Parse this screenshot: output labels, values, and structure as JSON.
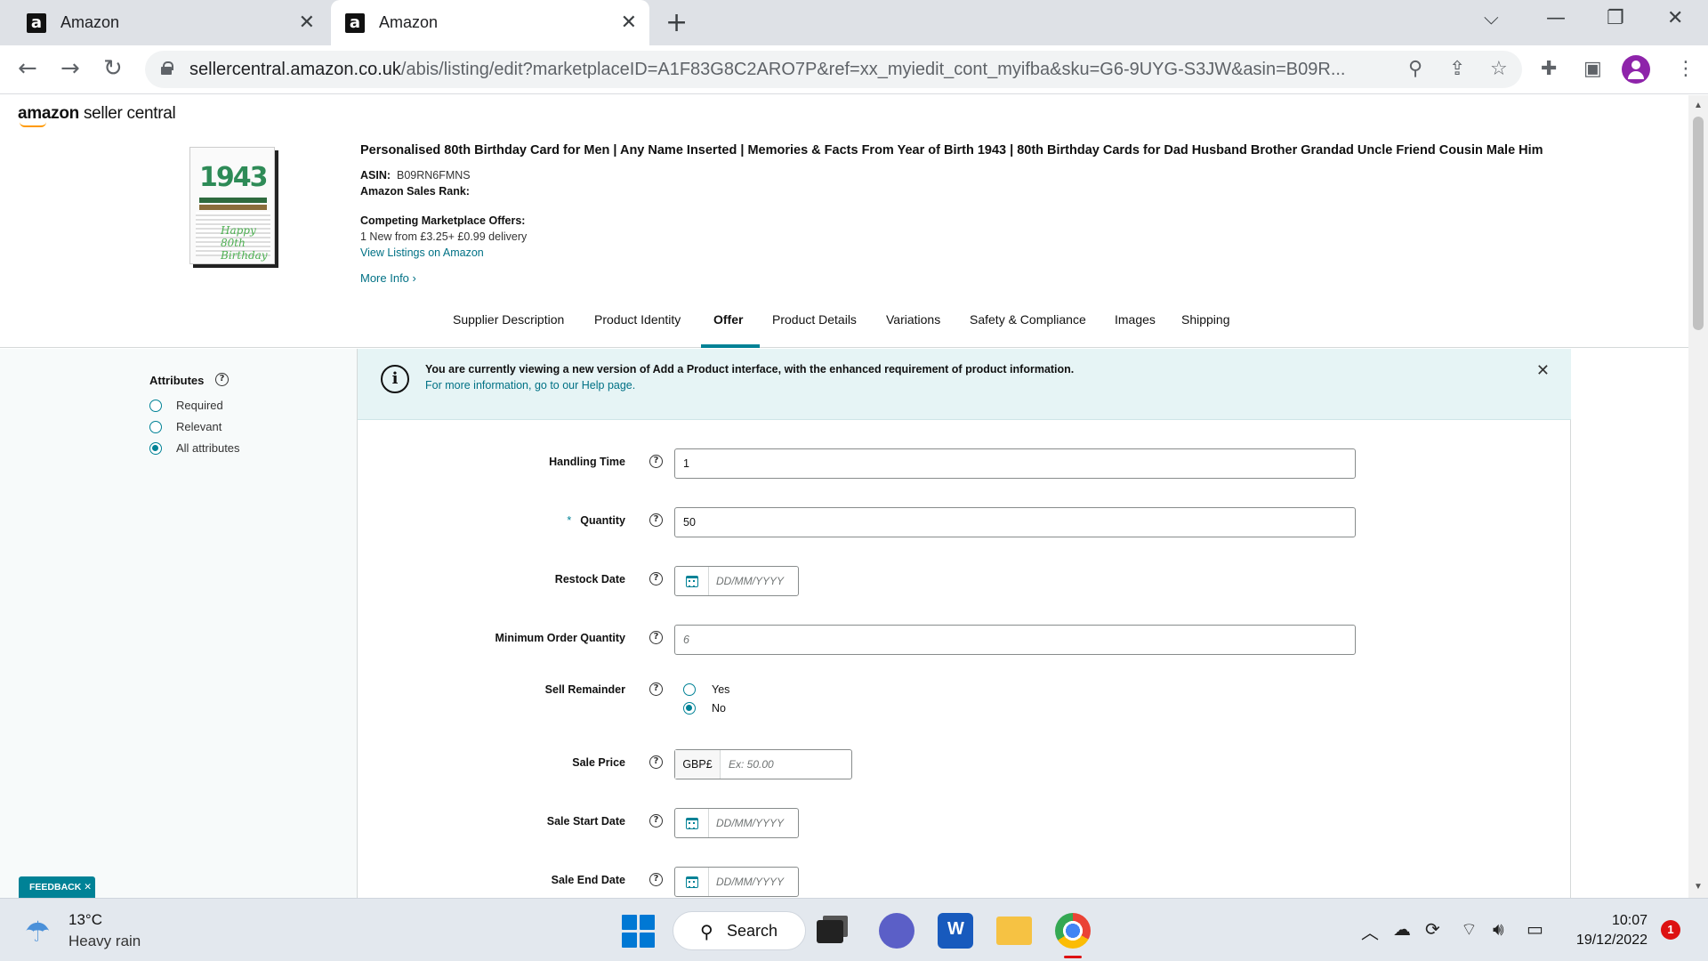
{
  "browser": {
    "tabs": [
      {
        "favicon": "a",
        "title": "Amazon"
      },
      {
        "favicon": "a",
        "title": "Amazon"
      }
    ],
    "url_host": "sellercentral.amazon.co.uk",
    "url_path": "/abis/listing/edit?marketplaceID=A1F83G8C2ARO7P&ref=xx_myiedit_cont_myifba&sku=G6-9UYG-S3JW&asin=B09R...",
    "icons": [
      "back-icon",
      "forward-icon",
      "reload-icon",
      "lock-icon",
      "zoom-icon",
      "share-icon",
      "star-icon",
      "extensions-icon",
      "side-panel-icon",
      "profile-avatar",
      "menu-icon"
    ]
  },
  "header": {
    "logo_brand": "amazon",
    "logo_product": "seller central"
  },
  "product": {
    "image_year": "1943",
    "image_caption": "Happy 80th Birthday",
    "title": "Personalised 80th Birthday Card for Men | Any Name Inserted | Memories & Facts From Year of Birth 1943 | 80th Birthday Cards for Dad Husband Brother Grandad Uncle Friend Cousin Male Him",
    "asin_label": "ASIN:",
    "asin_value": "B09RN6FMNS",
    "rank_label": "Amazon Sales Rank:",
    "offers_label": "Competing Marketplace Offers:",
    "offers_value": "1 New  from £3.25+ £0.99 delivery",
    "view_listings": "View Listings on Amazon",
    "more_info": "More Info"
  },
  "tabs": [
    {
      "label": "Supplier Description"
    },
    {
      "label": "Product Identity"
    },
    {
      "label": "Offer",
      "active": true
    },
    {
      "label": "Product Details"
    },
    {
      "label": "Variations"
    },
    {
      "label": "Safety & Compliance"
    },
    {
      "label": "Images"
    },
    {
      "label": "Shipping"
    }
  ],
  "sidebar": {
    "heading": "Attributes",
    "options": [
      {
        "label": "Required",
        "selected": false
      },
      {
        "label": "Relevant",
        "selected": false
      },
      {
        "label": "All attributes",
        "selected": true
      }
    ]
  },
  "banner": {
    "line1": "You are currently viewing a new version of Add a Product interface, with the enhanced requirement of product information.",
    "line2": "For more information, go to our Help page."
  },
  "form": {
    "handling_time": {
      "label": "Handling Time",
      "value": "1"
    },
    "quantity": {
      "label": "Quantity",
      "required_mark": "*",
      "value": "50"
    },
    "restock_date": {
      "label": "Restock Date",
      "placeholder": "DD/MM/YYYY"
    },
    "min_order_qty": {
      "label": "Minimum Order Quantity",
      "placeholder": "6"
    },
    "sell_remainder": {
      "label": "Sell Remainder",
      "yes": "Yes",
      "no": "No",
      "selected": "No"
    },
    "sale_price": {
      "label": "Sale Price",
      "currency": "GBP£",
      "placeholder": "Ex: 50.00"
    },
    "sale_start_date": {
      "label": "Sale Start Date",
      "placeholder": "DD/MM/YYYY"
    },
    "sale_end_date": {
      "label": "Sale End Date",
      "placeholder": "DD/MM/YYYY"
    }
  },
  "feedback": "FEEDBACK ✕",
  "taskbar": {
    "temperature": "13°C",
    "weather": "Heavy rain",
    "search_label": "Search",
    "time": "10:07",
    "date": "19/12/2022",
    "notifications": "1"
  },
  "colors": {
    "accent": "#008296",
    "link": "#007185",
    "banner_bg": "#e6f4f5",
    "sidebar_bg": "#f7fafa"
  }
}
